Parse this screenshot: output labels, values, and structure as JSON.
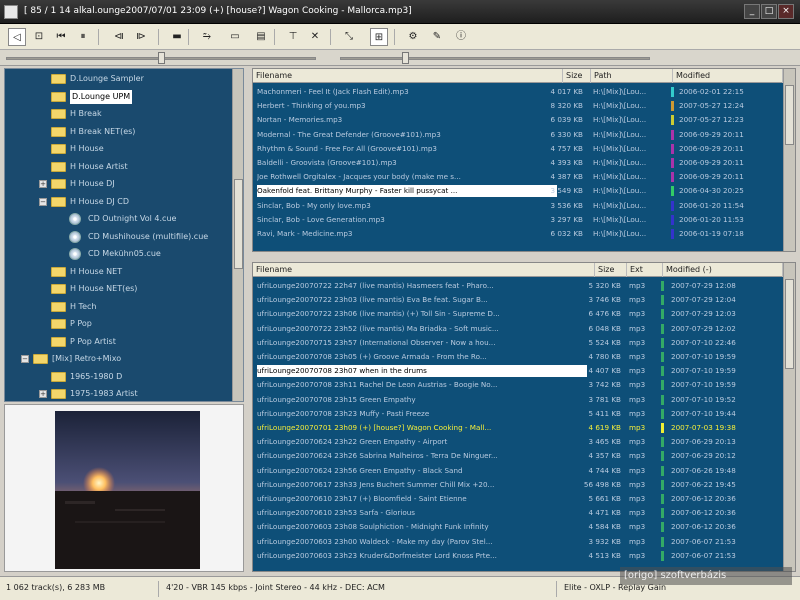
{
  "window": {
    "title": "[ 85 / 1 14 alkal.ounge2007/07/01 23:09 (+) [house?] Wagon Cooking - Mallorca.mp3]",
    "min": "_",
    "max": "□",
    "close": "×"
  },
  "toolbar": {
    "icons": [
      "back-icon",
      "stop-icon",
      "prev-icon",
      "pause-icon",
      "prev-track-icon",
      "next-track-icon",
      "eq-icon",
      "play-options-icon",
      "mini-window-icon",
      "playlist-window-icon",
      "filter-icon",
      "clear-icon",
      "sort-icon",
      "view-icon",
      "settings-icon",
      "edit-icon",
      "info-icon"
    ],
    "glyphs": [
      "◁",
      "⊡",
      "⏮",
      "⏸",
      "⧏",
      "⧐",
      "▬",
      "⥲",
      "▭",
      "▤",
      "⊤",
      "✕",
      "⤡",
      "⊞",
      "⚙",
      "✎",
      "ⓘ"
    ]
  },
  "seek": {
    "position": 0.49,
    "volume": 0.2
  },
  "tree": {
    "items": [
      {
        "label": "D.Lounge Sampler",
        "type": "folder",
        "depth": 2
      },
      {
        "label": "D.Lounge UPM",
        "type": "folder",
        "depth": 2,
        "selected": true
      },
      {
        "label": "H Break",
        "type": "folder",
        "depth": 2
      },
      {
        "label": "H Break NET(es)",
        "type": "folder",
        "depth": 2
      },
      {
        "label": "H House",
        "type": "folder",
        "depth": 2
      },
      {
        "label": "H House Artist",
        "type": "folder",
        "depth": 2
      },
      {
        "label": "H House DJ",
        "type": "folder",
        "depth": 2,
        "expander": "+"
      },
      {
        "label": "H House DJ CD",
        "type": "folder",
        "depth": 2,
        "expander": "−"
      },
      {
        "label": "CD Outnight Vol 4.cue",
        "type": "disc",
        "depth": 3
      },
      {
        "label": "CD Mushihouse (multifile).cue",
        "type": "disc",
        "depth": 3
      },
      {
        "label": "CD Mekühn05.cue",
        "type": "disc",
        "depth": 3
      },
      {
        "label": "H House NET",
        "type": "folder",
        "depth": 2
      },
      {
        "label": "H House NET(es)",
        "type": "folder",
        "depth": 2
      },
      {
        "label": "H Tech",
        "type": "folder",
        "depth": 2
      },
      {
        "label": "P Pop",
        "type": "folder",
        "depth": 2
      },
      {
        "label": "P Pop Artist",
        "type": "folder",
        "depth": 2
      },
      {
        "label": "[Mix] Retro+Mixo",
        "type": "folder",
        "depth": 1,
        "expander": "−"
      },
      {
        "label": "1965-1980 D",
        "type": "folder",
        "depth": 2
      },
      {
        "label": "1975-1983 Artist",
        "type": "folder",
        "depth": 2,
        "expander": "+"
      }
    ]
  },
  "top_list": {
    "columns": [
      "Filename",
      "Size",
      "Path",
      "Modified"
    ],
    "rows": [
      {
        "name": "Machonmeri - Feel It (Jack Flash Edit).mp3",
        "size": "4 017 KB",
        "path": "H:\\[Mix]\\[Lou...",
        "mod": "2006-02-01 22:15",
        "color": "#3cc"
      },
      {
        "name": "Herbert - Thinking of you.mp3",
        "size": "8 320 KB",
        "path": "H:\\[Mix]\\[Lou...",
        "mod": "2007-05-27 12:24",
        "color": "#c93"
      },
      {
        "name": "Nortan - Memories.mp3",
        "size": "6 039 KB",
        "path": "H:\\[Mix]\\[Lou...",
        "mod": "2007-05-27 12:23",
        "color": "#cc3"
      },
      {
        "name": "Modernal - The Great Defender (Groove#101).mp3",
        "size": "6 330 KB",
        "path": "H:\\[Mix]\\[Lou...",
        "mod": "2006-09-29 20:11",
        "color": "#a3a"
      },
      {
        "name": "Rhythm & Sound - Free For All (Groove#101).mp3",
        "size": "4 757 KB",
        "path": "H:\\[Mix]\\[Lou...",
        "mod": "2006-09-29 20:11",
        "color": "#a3a"
      },
      {
        "name": "Baldelli - Groovista (Groove#101).mp3",
        "size": "4 393 KB",
        "path": "H:\\[Mix]\\[Lou...",
        "mod": "2006-09-29 20:11",
        "color": "#a3a"
      },
      {
        "name": "Joe Rothwell Orgitalex - Jacques your body (make me s...",
        "size": "4 387 KB",
        "path": "H:\\[Mix]\\[Lou...",
        "mod": "2006-09-29 20:11",
        "color": "#a3a"
      },
      {
        "name": "Oakenfold feat. Brittany Murphy - Faster kill pussycat ...",
        "size": "3 549 KB",
        "path": "H:\\[Mix]\\[Lou...",
        "mod": "2006-04-30 20:25",
        "color": "#3c6",
        "selected": true
      },
      {
        "name": "Sinclar, Bob - My only love.mp3",
        "size": "3 536 KB",
        "path": "H:\\[Mix]\\[Lou...",
        "mod": "2006-01-20 11:54",
        "color": "#33c"
      },
      {
        "name": "Sinclar, Bob - Love Generation.mp3",
        "size": "3 297 KB",
        "path": "H:\\[Mix]\\[Lou...",
        "mod": "2006-01-20 11:53",
        "color": "#33c"
      },
      {
        "name": "Ravi, Mark - Medicine.mp3",
        "size": "6 032 KB",
        "path": "H:\\[Mix]\\[Lou...",
        "mod": "2006-01-19 07:18",
        "color": "#33c"
      }
    ]
  },
  "bottom_list": {
    "columns": [
      "Filename",
      "Size",
      "Ext",
      "Modified (-)"
    ],
    "rows": [
      {
        "name": "ufriLounge20070722 22h47 (live mantis) Hasmeers feat - Pharo...",
        "size": "5 320 KB",
        "ext": "mp3",
        "mod": "2007-07-29 12:08",
        "color": "#3a6"
      },
      {
        "name": "ufriLounge20070722 23h03 (live mantis) Eva Be feat. Sugar B...",
        "size": "3 746 KB",
        "ext": "mp3",
        "mod": "2007-07-29 12:04",
        "color": "#3a6"
      },
      {
        "name": "ufriLounge20070722 23h06 (live mantis) (+) Toll Sin - Supreme D...",
        "size": "6 476 KB",
        "ext": "mp3",
        "mod": "2007-07-29 12:03",
        "color": "#3a6"
      },
      {
        "name": "ufriLounge20070722 23h52 (live mantis) Ma Briadka - Soft music...",
        "size": "6 048 KB",
        "ext": "mp3",
        "mod": "2007-07-29 12:02",
        "color": "#3a6"
      },
      {
        "name": "ufriLounge20070715 23h57 (International Observer - Now a hou...",
        "size": "5 524 KB",
        "ext": "mp3",
        "mod": "2007-07-10 22:46",
        "color": "#3a6"
      },
      {
        "name": "ufriLounge20070708 23h05 (+) Groove Armada - From the Ro...",
        "size": "4 780 KB",
        "ext": "mp3",
        "mod": "2007-07-10 19:59",
        "color": "#3a6"
      },
      {
        "name": "ufriLounge20070708 23h07 when in the drums",
        "size": "4 407 KB",
        "ext": "mp3",
        "mod": "2007-07-10 19:59",
        "color": "#3a6",
        "selected": true
      },
      {
        "name": "ufriLounge20070708 23h11 Rachel De Leon Austrias - Boogie No...",
        "size": "3 742 KB",
        "ext": "mp3",
        "mod": "2007-07-10 19:59",
        "color": "#3a6"
      },
      {
        "name": "ufriLounge20070708 23h15 Green Empathy",
        "size": "3 781 KB",
        "ext": "mp3",
        "mod": "2007-07-10 19:52",
        "color": "#3a6"
      },
      {
        "name": "ufriLounge20070708 23h23 Muffy - Pasti Freeze",
        "size": "5 411 KB",
        "ext": "mp3",
        "mod": "2007-07-10 19:44",
        "color": "#3a6"
      },
      {
        "name": "ufriLounge20070701 23h09 (+) [house?] Wagon Cooking - Mall...",
        "size": "4 619 KB",
        "ext": "mp3",
        "mod": "2007-07-03 19:38",
        "color": "#ee3",
        "playing": true
      },
      {
        "name": "ufriLounge20070624 23h22 Green Empathy - Airport",
        "size": "3 465 KB",
        "ext": "mp3",
        "mod": "2007-06-29 20:13",
        "color": "#3a6"
      },
      {
        "name": "ufriLounge20070624 23h26 Sabrina Malheiros - Terra De Ninguer...",
        "size": "4 357 KB",
        "ext": "mp3",
        "mod": "2007-06-29 20:12",
        "color": "#3a6"
      },
      {
        "name": "ufriLounge20070624 23h56 Green Empathy - Black Sand",
        "size": "4 744 KB",
        "ext": "mp3",
        "mod": "2007-06-26 19:48",
        "color": "#3a6"
      },
      {
        "name": "ufriLounge20070617 23h33 Jens Buchert Summer Chill Mix +20...",
        "size": "56 498 KB",
        "ext": "mp3",
        "mod": "2007-06-22 19:45",
        "color": "#3a6"
      },
      {
        "name": "ufriLounge20070610 23h17 (+) Bloomfield - Saint Etienne",
        "size": "5 661 KB",
        "ext": "mp3",
        "mod": "2007-06-12 20:36",
        "color": "#3a6"
      },
      {
        "name": "ufriLounge20070610 23h53 Sarfa - Glorious",
        "size": "4 471 KB",
        "ext": "mp3",
        "mod": "2007-06-12 20:36",
        "color": "#3a6"
      },
      {
        "name": "ufriLounge20070603 23h08 Soulphiction - Midnight Funk Infinity",
        "size": "4 584 KB",
        "ext": "mp3",
        "mod": "2007-06-12 20:36",
        "color": "#3a6"
      },
      {
        "name": "ufriLounge20070603 23h00 Waldeck - Make my day (Parov Stel...",
        "size": "3 932 KB",
        "ext": "mp3",
        "mod": "2007-06-07 21:53",
        "color": "#3a6"
      },
      {
        "name": "ufriLounge20070603 23h23 Kruder&Dorfmeister Lord Knoss Prte...",
        "size": "4 513 KB",
        "ext": "mp3",
        "mod": "2007-06-07 21:53",
        "color": "#3a6"
      }
    ]
  },
  "status": {
    "left": "1 062 track(s), 6 283 MB",
    "mid": "4'20 - VBR 145 kbps - Joint Stereo - 44 kHz - DEC: ACM",
    "right": "Elite - OXLP - Replay Gain"
  },
  "watermark": "[origo] szoftverbázis"
}
